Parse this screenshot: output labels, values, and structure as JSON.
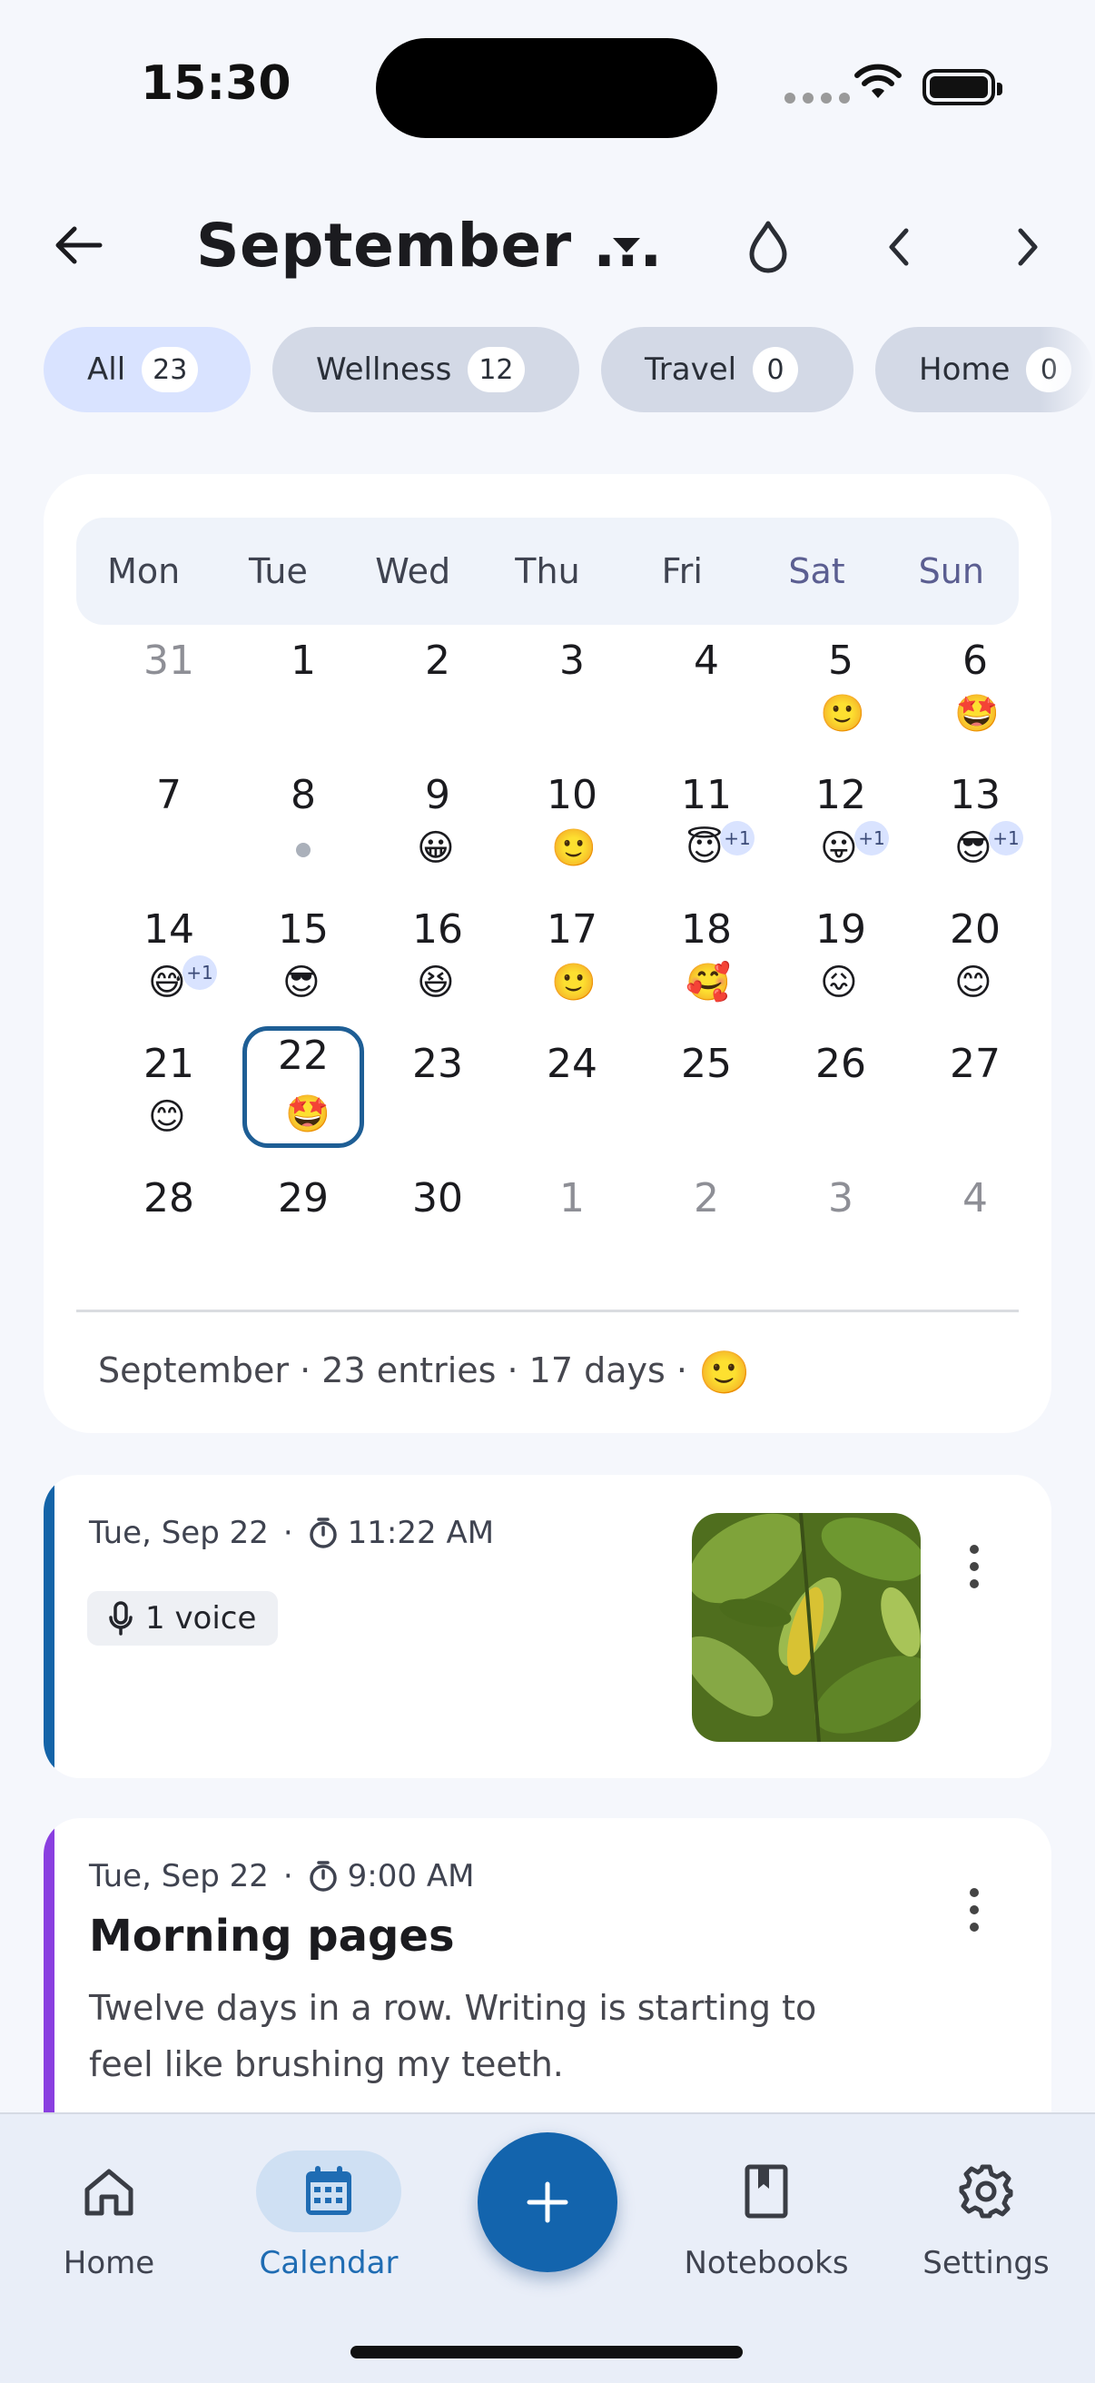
{
  "status": {
    "time": "15:30"
  },
  "header": {
    "title": "September ..."
  },
  "chips": [
    {
      "label": "All",
      "count": "23"
    },
    {
      "label": "Wellness",
      "count": "12"
    },
    {
      "label": "Travel",
      "count": "0"
    },
    {
      "label": "Home",
      "count": "0"
    }
  ],
  "calendar": {
    "weekdays": [
      "Mon",
      "Tue",
      "Wed",
      "Thu",
      "Fri",
      "Sat",
      "Sun"
    ],
    "days": [
      {
        "n": "31",
        "muted": true
      },
      {
        "n": "1"
      },
      {
        "n": "2"
      },
      {
        "n": "3"
      },
      {
        "n": "4"
      },
      {
        "n": "5",
        "e": "🙂"
      },
      {
        "n": "6",
        "e": "🤩"
      },
      {
        "n": "7"
      },
      {
        "n": "8",
        "dot": true
      },
      {
        "n": "9",
        "e": "😀"
      },
      {
        "n": "10",
        "e": "🙂"
      },
      {
        "n": "11",
        "e": "😇",
        "plus": "+1"
      },
      {
        "n": "12",
        "e": "😛",
        "plus": "+1"
      },
      {
        "n": "13",
        "e": "😎",
        "plus": "+1"
      },
      {
        "n": "14",
        "e": "😅",
        "plus": "+1"
      },
      {
        "n": "15",
        "e": "😎"
      },
      {
        "n": "16",
        "e": "😆"
      },
      {
        "n": "17",
        "e": "🙂"
      },
      {
        "n": "18",
        "e": "🥰"
      },
      {
        "n": "19",
        "e": "😖"
      },
      {
        "n": "20",
        "e": "😊"
      },
      {
        "n": "21",
        "e": "😊"
      },
      {
        "n": "22",
        "e": "🤩",
        "today": true
      },
      {
        "n": "23"
      },
      {
        "n": "24"
      },
      {
        "n": "25"
      },
      {
        "n": "26"
      },
      {
        "n": "27"
      },
      {
        "n": "28"
      },
      {
        "n": "29"
      },
      {
        "n": "30"
      },
      {
        "n": "1",
        "muted": true
      },
      {
        "n": "2",
        "muted": true
      },
      {
        "n": "3",
        "muted": true
      },
      {
        "n": "4",
        "muted": true
      }
    ],
    "summary": "September · 23 entries · 17 days ·",
    "summary_emoji": "🙂"
  },
  "entries": [
    {
      "date": "Tue, Sep 22",
      "time": "11:22 AM",
      "voice": "1 voice",
      "accent": "#1464A8"
    },
    {
      "date": "Tue, Sep 22",
      "time": "9:00 AM",
      "title": "Morning pages",
      "body": "Twelve days in a row. Writing is starting to feel like brushing my teeth.",
      "accent": "#8A3FE0"
    }
  ],
  "nav": {
    "home": "Home",
    "calendar": "Calendar",
    "notebooks": "Notebooks",
    "settings": "Settings"
  },
  "colors": {
    "primary": "#1364AD",
    "selected_chip": "#D9E3FF"
  }
}
